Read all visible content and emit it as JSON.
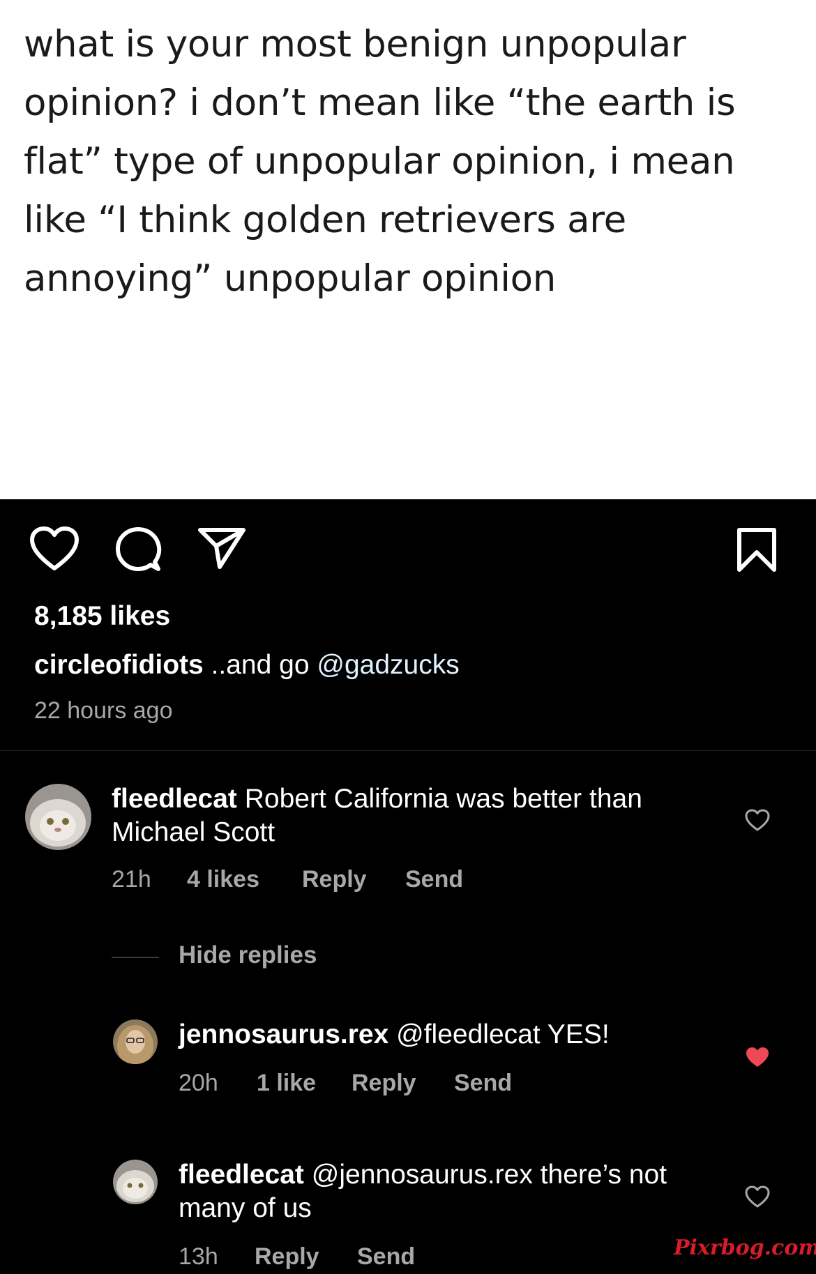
{
  "post": {
    "text": "what is your most benign unpopular opinion? i don’t mean like “the earth is flat” type of unpopular opinion, i mean like “I think golden retrievers are annoying” unpopular opinion"
  },
  "stats": {
    "likes": "8,185 likes"
  },
  "caption": {
    "username": "circleofidiots",
    "text": " ..and go ",
    "mention": "@gadzucks",
    "time_ago": "22 hours ago"
  },
  "comments": [
    {
      "username": "fleedlecat",
      "text": " Robert California was better than Michael Scott",
      "time": "21h",
      "likes": "4 likes",
      "reply": "Reply",
      "send": "Send",
      "liked": false
    },
    {
      "username": "jennosaurus.rex",
      "text": " @fleedlecat YES!",
      "time": "20h",
      "likes": "1 like",
      "reply": "Reply",
      "send": "Send",
      "liked": true
    },
    {
      "username": "fleedlecat",
      "text": " @jennosaurus.rex there’s not many of us",
      "time": "13h",
      "reply": "Reply",
      "send": "Send",
      "liked": false
    }
  ],
  "hide_replies": "Hide replies",
  "watermark": "Pixrbog.com",
  "colors": {
    "background": "#000000",
    "post_bg": "#ffffff",
    "muted_text": "#a8a8a8",
    "liked_heart": "#ed4956",
    "watermark": "#d81d2a"
  },
  "icons": [
    "heart-icon",
    "comment-icon",
    "share-icon",
    "bookmark-icon",
    "like-heart-icon",
    "liked-heart-icon"
  ]
}
